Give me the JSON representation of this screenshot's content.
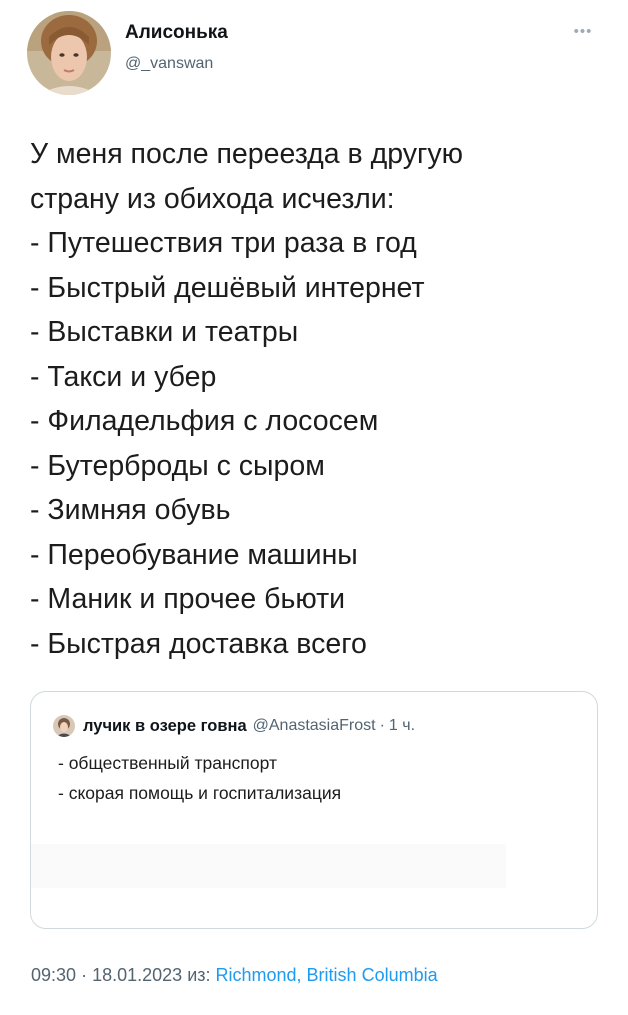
{
  "author": {
    "display_name": "Алисонька",
    "handle": "@_vanswan"
  },
  "tweet": {
    "lines": [
      "У меня после переезда в другую",
      "страну из обихода исчезли:",
      "- Путешествия три раза в год",
      "- Быстрый дешёвый интернет",
      "- Выставки и театры",
      "- Такси и убер",
      "- Филадельфия с лососем",
      "- Бутерброды с сыром",
      "- Зимняя обувь",
      "- Переобувание машины",
      "- Маник и прочее бьюти",
      "- Быстрая доставка всего"
    ]
  },
  "quote": {
    "display_name": "лучик в озере говна",
    "handle": "@AnastasiaFrost",
    "separator": "·",
    "time": "1 ч.",
    "lines": [
      "- общественный транспорт",
      "- скорая помощь и госпитализация"
    ]
  },
  "meta": {
    "time": "09:30",
    "separator": "·",
    "date": "18.01.2023",
    "from_label": "из:",
    "location": "Richmond, British Columbia"
  },
  "icons": {
    "more": "more-horizontal-icon"
  },
  "colors": {
    "text": "#0f1419",
    "secondary": "#536471",
    "link": "#1d9bf0",
    "border": "#cfd9de"
  }
}
